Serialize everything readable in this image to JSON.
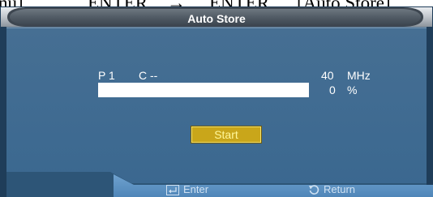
{
  "document_text": {
    "left_fragment": "nu]",
    "enter_word_1": "ENTER",
    "arrow": "→",
    "enter_word_2": "ENTER",
    "bracket_text": "[Auto Store]"
  },
  "dialog": {
    "title": "Auto Store",
    "program_label": "P 1",
    "channel_label": "C --",
    "frequency_value": "40",
    "frequency_unit": "MHz",
    "progress_value": "0",
    "progress_unit": "%",
    "progress_fraction": 0,
    "start_label": "Start"
  },
  "footer": {
    "enter_label": "Enter",
    "return_label": "Return",
    "enter_icon": "enter-icon",
    "return_icon": "return-icon"
  },
  "colors": {
    "panel_blue": "#3c6c94",
    "header_gray": "#c9ced4",
    "footer_blue": "#5e92c0",
    "button_gold": "#c9a61a"
  }
}
